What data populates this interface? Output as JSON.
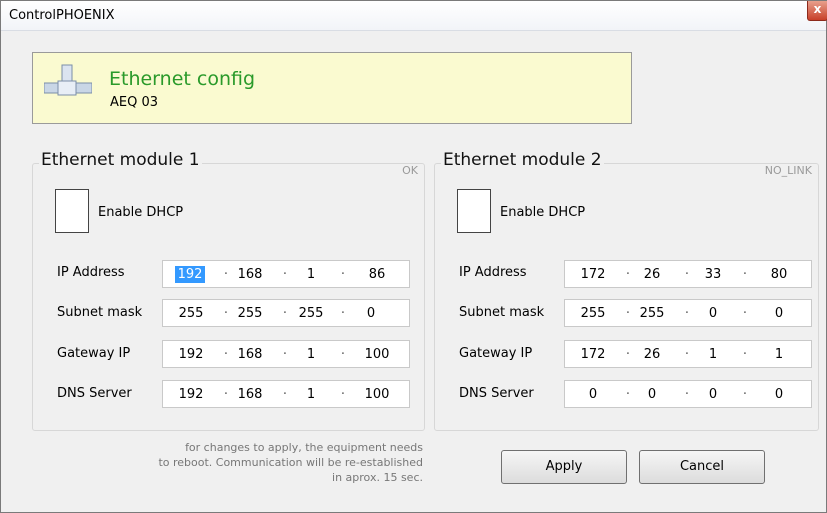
{
  "window": {
    "title": "ControlPHOENIX",
    "close_label": "x"
  },
  "banner": {
    "title": "Ethernet config",
    "subtitle": "AEQ 03"
  },
  "modules": [
    {
      "title": "Ethernet module 1",
      "status": "OK",
      "dhcp_label": "Enable DHCP",
      "dhcp_checked": false,
      "fields": [
        {
          "label": "IP Address",
          "octets": [
            "192",
            "168",
            "1",
            "86"
          ]
        },
        {
          "label": "Subnet mask",
          "octets": [
            "255",
            "255",
            "255",
            "0"
          ]
        },
        {
          "label": "Gateway IP",
          "octets": [
            "192",
            "168",
            "1",
            "100"
          ]
        },
        {
          "label": "DNS Server",
          "octets": [
            "192",
            "168",
            "1",
            "100"
          ]
        }
      ]
    },
    {
      "title": "Ethernet module 2",
      "status": "NO_LINK",
      "dhcp_label": "Enable DHCP",
      "dhcp_checked": false,
      "fields": [
        {
          "label": "IP Address",
          "octets": [
            "172",
            "26",
            "33",
            "80"
          ]
        },
        {
          "label": "Subnet mask",
          "octets": [
            "255",
            "255",
            "0",
            "0"
          ]
        },
        {
          "label": "Gateway IP",
          "octets": [
            "172",
            "26",
            "1",
            "1"
          ]
        },
        {
          "label": "DNS Server",
          "octets": [
            "0",
            "0",
            "0",
            "0"
          ]
        }
      ]
    }
  ],
  "note": {
    "line1": "for changes to apply, the equipment needs",
    "line2": "to reboot. Communication will be re-established",
    "line3": "in aprox. 15 sec."
  },
  "buttons": {
    "apply": "Apply",
    "cancel": "Cancel"
  },
  "colors": {
    "banner_bg": "#fafad0",
    "banner_title": "#2a9a2a",
    "selection": "#3399ff"
  }
}
